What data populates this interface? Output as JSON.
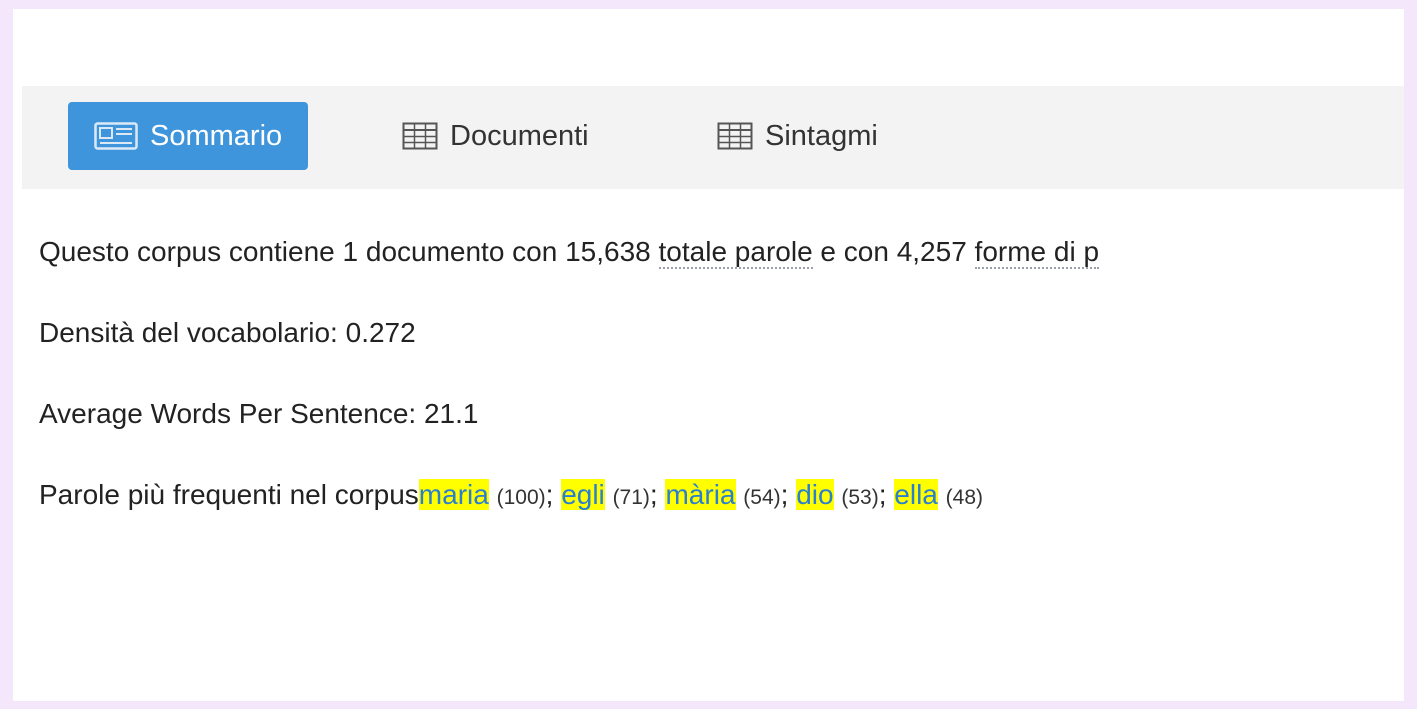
{
  "tabs": [
    {
      "label": "Sommario",
      "icon": "summary-icon",
      "active": true
    },
    {
      "label": "Documenti",
      "icon": "table-icon",
      "active": false
    },
    {
      "label": "Sintagmi",
      "icon": "table-icon",
      "active": false
    }
  ],
  "summary": {
    "line1_prefix": "Questo corpus contiene 1 documento con 15,638 ",
    "line1_total": "totale parole",
    "line1_mid": " e con 4,257 ",
    "line1_forms": "forme di p",
    "density": "Densità del vocabolario: 0.272",
    "avg_words": "Average Words Per Sentence: 21.1",
    "frequent_label": "Parole più frequenti nel corpus",
    "frequent_words": [
      {
        "word": "maria",
        "count": "(100)",
        "sep": "; "
      },
      {
        "word": "egli",
        "count": "(71)",
        "sep": "; "
      },
      {
        "word": "mària",
        "count": "(54)",
        "sep": "; "
      },
      {
        "word": "dio",
        "count": "(53)",
        "sep": "; "
      },
      {
        "word": "ella",
        "count": "(48)",
        "sep": ""
      }
    ]
  },
  "colors": {
    "accent": "#3e95db",
    "highlight": "#ffff00",
    "link": "#2a7fd0"
  }
}
